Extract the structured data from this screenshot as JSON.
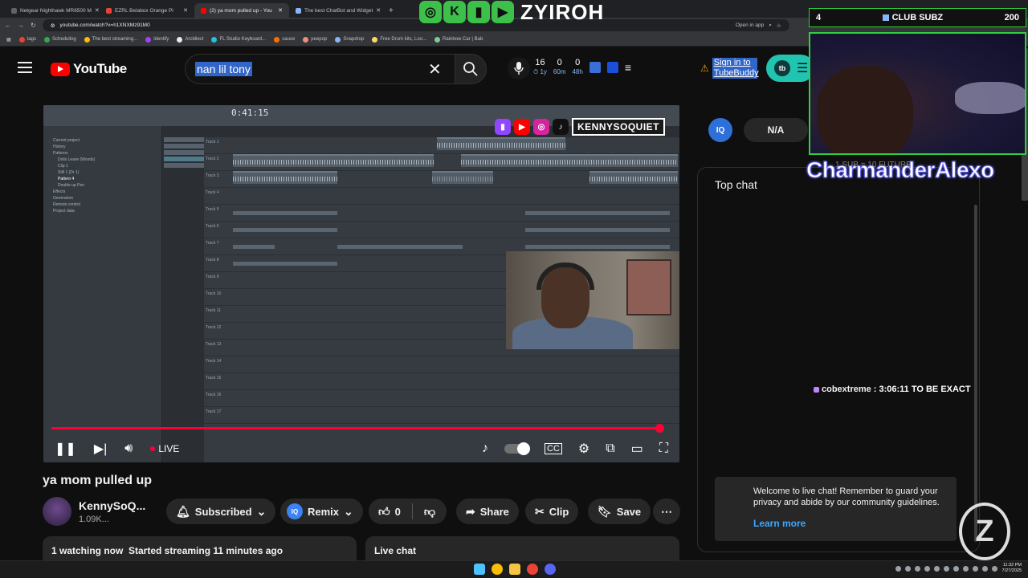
{
  "browser": {
    "tabs": [
      {
        "label": "Netgear Nighthawk MR6500 M"
      },
      {
        "label": "EZRL Belabox Orange Pi"
      },
      {
        "label": "(2) ya mom pulled up - You",
        "active": true
      },
      {
        "label": "The best ChatBot and Widget"
      }
    ],
    "new_tab": "+",
    "url": "youtube.com/watch?v=h1XNXMz91M0",
    "open_in_app": "Open in app",
    "bookmarks": [
      {
        "label": "tags",
        "color": "#ea4335"
      },
      {
        "label": "Scheduling",
        "color": "#34a853"
      },
      {
        "label": "The best streaming...",
        "color": "#fbbc04"
      },
      {
        "label": "Identify",
        "color": "#a142f4"
      },
      {
        "label": "Arcbllect",
        "color": "#e8eaed"
      },
      {
        "label": "FL Studio Keyboard...",
        "color": "#24c1e0"
      },
      {
        "label": "sauce",
        "color": "#ff6d00"
      },
      {
        "label": "peepop",
        "color": "#f28b82"
      },
      {
        "label": "Snapdrop",
        "color": "#8ab4f8"
      },
      {
        "label": "Free Drum kits, Loo...",
        "color": "#fdd663"
      },
      {
        "label": "Rainbow Car | Bab",
        "color": "#81c995"
      }
    ]
  },
  "header": {
    "logo_text": "YouTube",
    "search_value": "nan lil tony",
    "clear_icon": "✕",
    "stats": [
      {
        "value": "16",
        "label": "1y"
      },
      {
        "value": "0",
        "label": "60m"
      },
      {
        "value": "0",
        "label": "48h"
      }
    ],
    "signin_text": "Sign in to TubeBuddy",
    "iq_label": "IQ",
    "na_label": "N/A"
  },
  "player": {
    "daw_clock": "0:41:15",
    "browser_items": [
      "Current project",
      "History",
      "Patterns",
      "Dolls Leave (Woods)",
      "Clip 1",
      "Still 1 (Dr 1)",
      "Pattern 4",
      "Double up Pen",
      "Effects",
      "Generators",
      "Remote control",
      "Project data"
    ],
    "track_labels": [
      "Track 1",
      "Track 2",
      "Track 3",
      "Track 4",
      "Track 5",
      "Track 6",
      "Track 7",
      "Track 8",
      "Track 9",
      "Track 10",
      "Track 11",
      "Track 12",
      "Track 13",
      "Track 14",
      "Track 15",
      "Track 16",
      "Track 17"
    ],
    "streamer_tag": "KENNYSOQUIET",
    "live_label": "LIVE",
    "progress_fraction": 0.98
  },
  "video": {
    "title": "ya mom pulled up",
    "channel_name": "KennySoQ...",
    "subscribers": "1.09K...",
    "subscribed_label": "Subscribed",
    "remix_label": "Remix",
    "like_count": "0",
    "share_label": "Share",
    "clip_label": "Clip",
    "save_label": "Save",
    "watching_text": "1 watching now  Started streaming 11 minutes ago",
    "live_chat_label": "Live chat"
  },
  "chat": {
    "header": "Top chat",
    "message_user": "cobextreme",
    "message_text": ": 3:06:11 TO BE EXACT",
    "welcome_text": "Welcome to live chat! Remember to guard your privacy and abide by our community guidelines.",
    "learn_more": "Learn more"
  },
  "overlay": {
    "brand_name": "ZYIROH",
    "subs_count": "4",
    "subs_title": "CLUB SUBZ",
    "subs_goal": "200",
    "ticker_text": "CharmanderAlexo",
    "ticker_sub": "1 SUB = 10 FUTURE",
    "z_letter": "Z"
  },
  "taskbar": {
    "time": "11:32 PM",
    "date": "7/27/2025"
  }
}
